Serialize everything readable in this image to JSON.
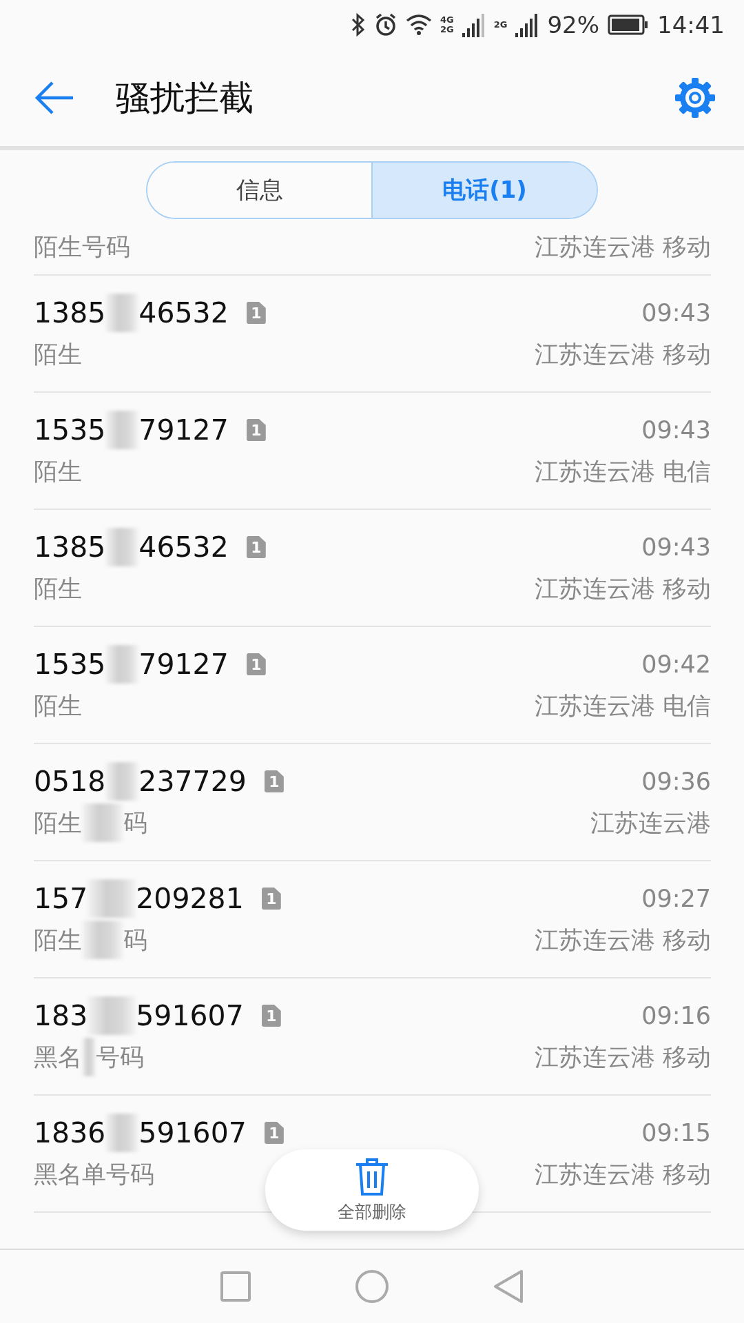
{
  "status_bar": {
    "network_labels": [
      "4G",
      "2G",
      "2G"
    ],
    "battery": "92%",
    "time": "14:41"
  },
  "header": {
    "title": "骚扰拦截"
  },
  "tabs": [
    {
      "label": "信息",
      "selected": false
    },
    {
      "label": "电话(1)",
      "selected": true
    }
  ],
  "partial_row": {
    "label": "陌生号码",
    "location": "江苏连云港 移动"
  },
  "calls": [
    {
      "number_start": "1385",
      "number_end": "46532",
      "sim": "1",
      "label_start": "陌生",
      "time": "09:43",
      "location": "江苏连云港 移动"
    },
    {
      "number_start": "1535",
      "number_end": "79127",
      "sim": "1",
      "label_start": "陌生",
      "time": "09:43",
      "location": "江苏连云港 电信"
    },
    {
      "number_start": "1385",
      "number_end": "46532",
      "sim": "1",
      "label_start": "陌生",
      "time": "09:43",
      "location": "江苏连云港 移动"
    },
    {
      "number_start": "1535",
      "number_end": "79127",
      "sim": "1",
      "label_start": "陌生",
      "time": "09:42",
      "location": "江苏连云港 电信"
    },
    {
      "number_start": "0518",
      "number_end": "237729",
      "sim": "1",
      "label_start": "陌生",
      "label_end": "码",
      "time": "09:36",
      "location": "江苏连云港"
    },
    {
      "number_start": "157",
      "number_end": "209281",
      "sim": "1",
      "label_start": "陌生",
      "label_end": "码",
      "time": "09:27",
      "location": "江苏连云港 移动"
    },
    {
      "number_start": "183",
      "number_end": "591607",
      "sim": "1",
      "label_start": "黑名",
      "label_end": "号码",
      "time": "09:16",
      "location": "江苏连云港 移动"
    },
    {
      "number_start": "1836",
      "number_end": "591607",
      "sim": "1",
      "label_start": "黑名单号码",
      "time": "09:15",
      "location": "江苏连云港 移动"
    }
  ],
  "delete_all": {
    "label": "全部删除"
  }
}
